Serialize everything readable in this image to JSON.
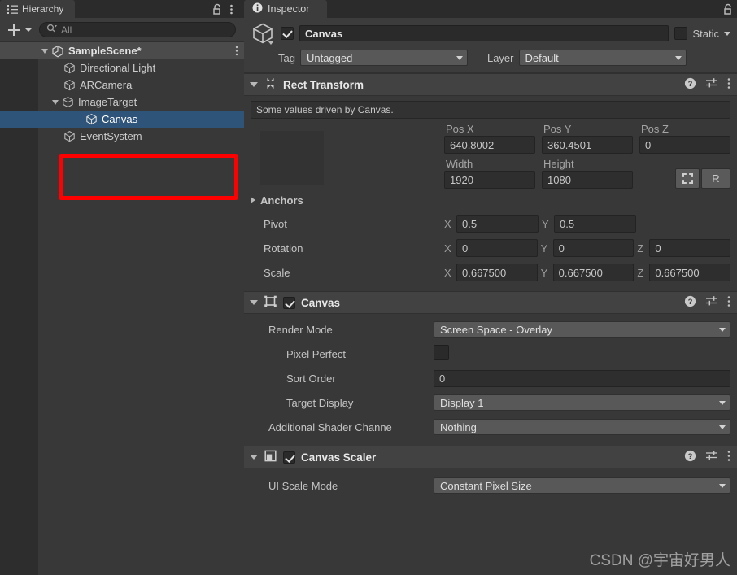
{
  "hierarchy": {
    "tab_label": "Hierarchy",
    "tab_icon": "hierarchy-list-icon",
    "lock_icon": "lock-open-icon",
    "menu_icon": "kebab-menu-icon",
    "create_button_label": "+",
    "search": {
      "placeholder": "All",
      "value": "",
      "icon": "search-icon"
    },
    "scene": {
      "label": "SampleScene*",
      "icon": "unity-scene-icon",
      "expanded": true
    },
    "items": [
      {
        "label": "Directional Light",
        "icon": "gameobject-cube-icon",
        "indent": 1,
        "selected": false,
        "expandable": false
      },
      {
        "label": "ARCamera",
        "icon": "gameobject-cube-icon",
        "indent": 1,
        "selected": false,
        "expandable": false
      },
      {
        "label": "ImageTarget",
        "icon": "gameobject-cube-icon",
        "indent": 1,
        "selected": false,
        "expandable": true
      },
      {
        "label": "Canvas",
        "icon": "gameobject-cube-icon",
        "indent": 2,
        "selected": true,
        "expandable": false
      },
      {
        "label": "EventSystem",
        "icon": "gameobject-cube-icon",
        "indent": 1,
        "selected": false,
        "expandable": false
      }
    ],
    "annotation_color": "#fe0000"
  },
  "inspector": {
    "tab_label": "Inspector",
    "tab_icon": "info-icon",
    "lock_icon": "lock-open-icon",
    "header": {
      "object_icon": "gameobject-cube-icon",
      "enabled": true,
      "name": "Canvas",
      "static_label": "Static",
      "static_checked": false,
      "tag_label": "Tag",
      "tag_value": "Untagged",
      "layer_label": "Layer",
      "layer_value": "Default"
    },
    "components": [
      {
        "title": "Rect Transform",
        "icon": "rect-transform-icon",
        "help_icon": "help-icon",
        "preset_icon": "preset-settings-icon",
        "menu_icon": "kebab-menu-icon",
        "info": "Some values driven by Canvas.",
        "fields": {
          "pos_x_label": "Pos X",
          "pos_x": "640.8002",
          "pos_y_label": "Pos Y",
          "pos_y": "360.4501",
          "pos_z_label": "Pos Z",
          "pos_z": "0",
          "width_label": "Width",
          "width": "1920",
          "height_label": "Height",
          "height": "1080",
          "blueprint_icon": "blueprint-mode-icon",
          "rawedit_label": "R",
          "anchors_label": "Anchors",
          "pivot_label": "Pivot",
          "pivot_x": "0.5",
          "pivot_y": "0.5",
          "rotation_label": "Rotation",
          "rot_x": "0",
          "rot_y": "0",
          "rot_z": "0",
          "scale_label": "Scale",
          "scale_x": "0.667500",
          "scale_y": "0.667500",
          "scale_z": "0.667500",
          "axis_x": "X",
          "axis_y": "Y",
          "axis_z": "Z"
        }
      },
      {
        "title": "Canvas",
        "icon": "canvas-icon",
        "enabled": true,
        "help_icon": "help-icon",
        "preset_icon": "preset-settings-icon",
        "menu_icon": "kebab-menu-icon",
        "rows": [
          {
            "label": "Render Mode",
            "type": "dropdown",
            "value": "Screen Space - Overlay"
          },
          {
            "label": "Pixel Perfect",
            "type": "checkbox",
            "value": false
          },
          {
            "label": "Sort Order",
            "type": "text",
            "value": "0"
          },
          {
            "label": "Target Display",
            "type": "dropdown",
            "value": "Display 1"
          },
          {
            "label": "Additional Shader Channe",
            "type": "dropdown",
            "value": "Nothing"
          }
        ]
      },
      {
        "title": "Canvas Scaler",
        "icon": "canvas-scaler-icon",
        "enabled": true,
        "help_icon": "help-icon",
        "preset_icon": "preset-settings-icon",
        "menu_icon": "kebab-menu-icon",
        "rows": [
          {
            "label": "UI Scale Mode",
            "type": "dropdown",
            "value": "Constant Pixel Size"
          }
        ]
      }
    ]
  },
  "watermark": "CSDN @宇宙好男人"
}
